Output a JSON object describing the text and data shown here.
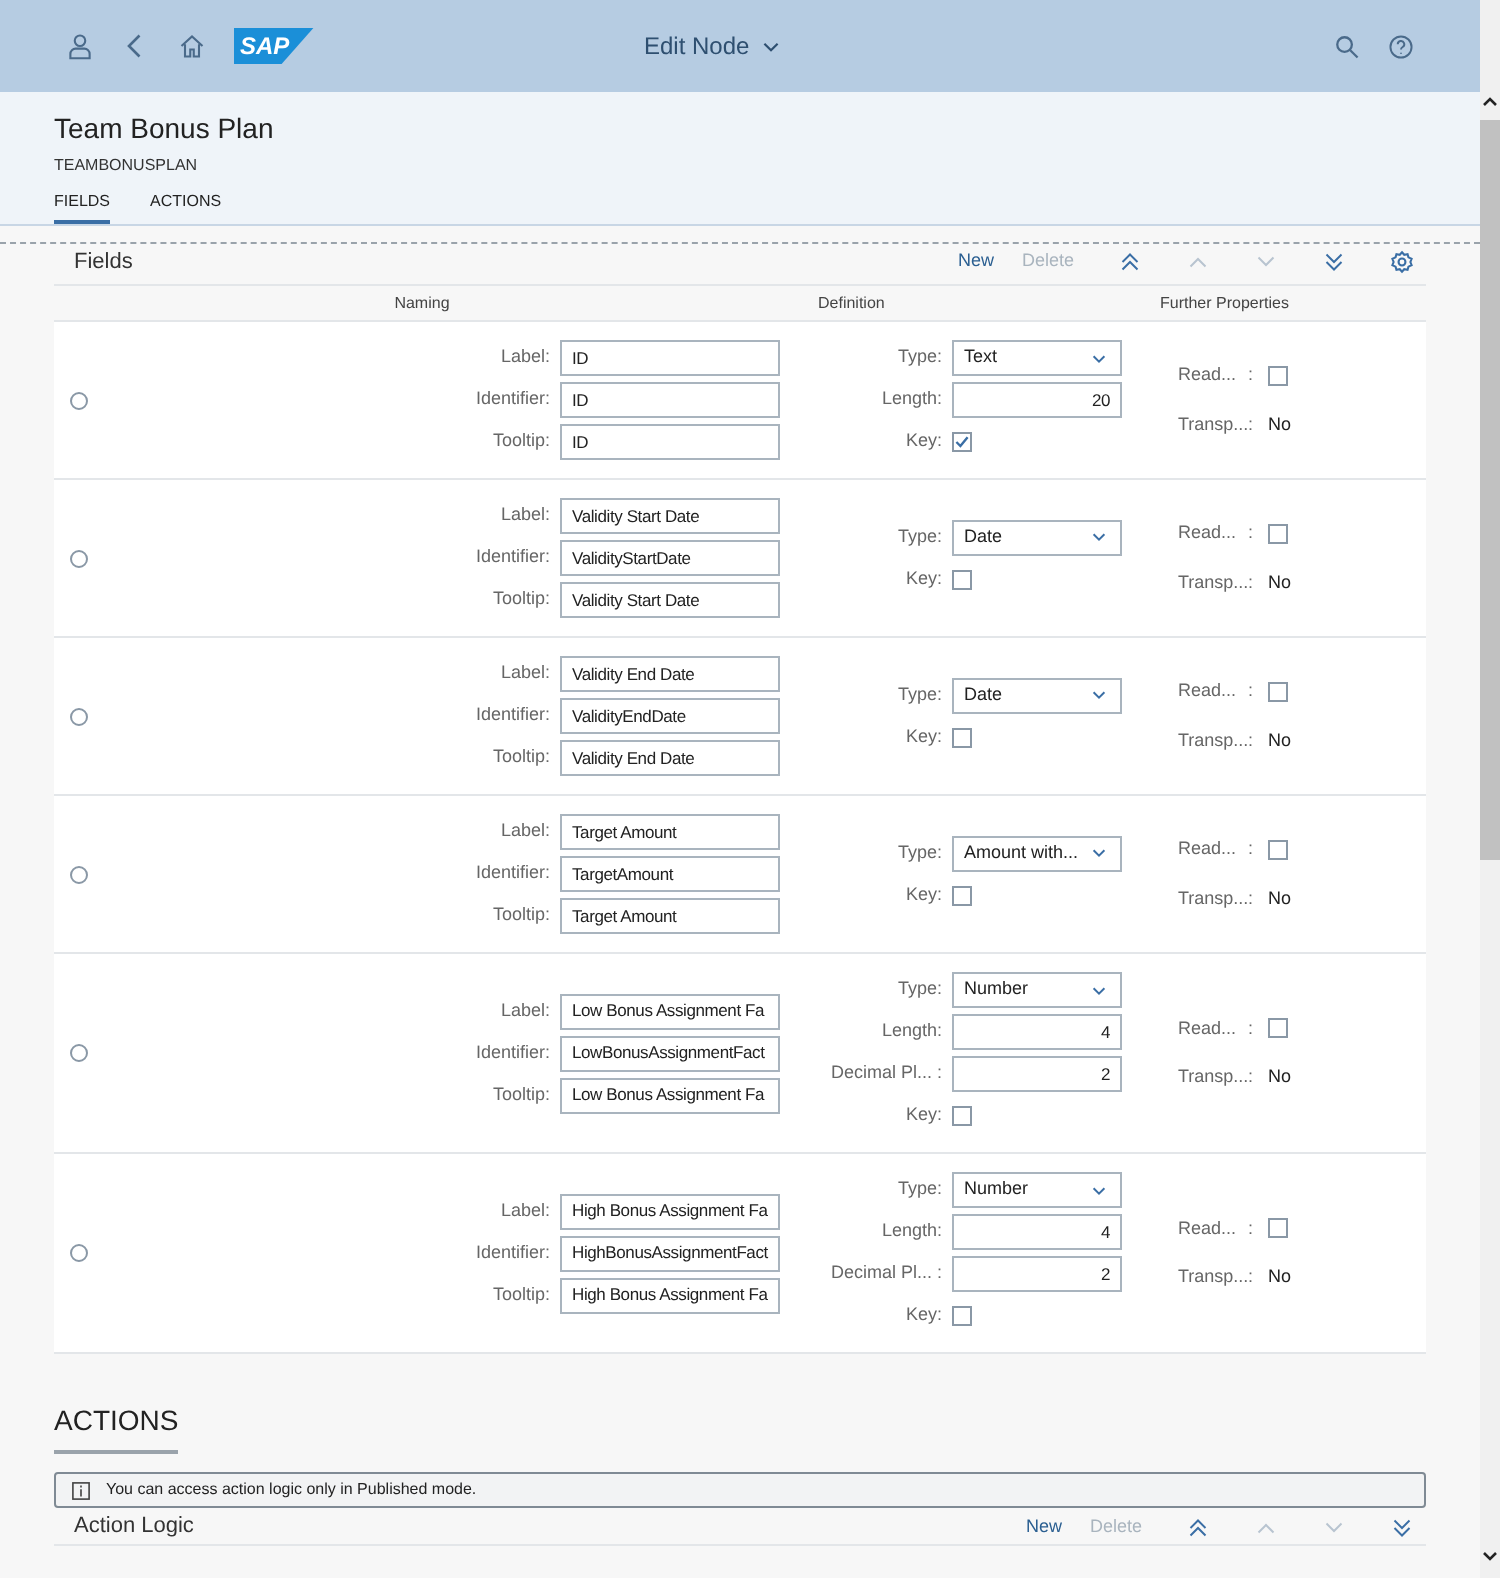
{
  "shell": {
    "title": "Edit Node",
    "logo": "SAP"
  },
  "header": {
    "title": "Team Bonus Plan",
    "subtitle": "TEAMBONUSPLAN"
  },
  "tabs": [
    {
      "label": "FIELDS",
      "selected": true
    },
    {
      "label": "ACTIONS",
      "selected": false
    }
  ],
  "fields": {
    "title": "Fields",
    "toolbar": {
      "new": {
        "label": "New",
        "disabled": false
      },
      "delete": {
        "label": "Delete",
        "disabled": true
      },
      "moves": [
        {
          "disabled": false
        },
        {
          "disabled": true
        },
        {
          "disabled": true
        },
        {
          "disabled": false
        }
      ]
    },
    "columns": [
      "Naming",
      "Definition",
      "Further Properties"
    ],
    "rows": [
      {
        "selected": false,
        "naming": [
          {
            "label": "Label:",
            "value": "ID"
          },
          {
            "label": "Identifier:",
            "value": "ID"
          },
          {
            "label": "Tooltip:",
            "value": "ID"
          }
        ],
        "definition": [
          {
            "kind": "select",
            "label": "Type:",
            "value": "Text"
          },
          {
            "kind": "number",
            "label": "Length:",
            "value": "20"
          },
          {
            "kind": "checkbox",
            "label": "Key:",
            "checked": true
          }
        ],
        "further": [
          {
            "kind": "checkbox",
            "label": "Read...",
            "colon": ":",
            "checked": false
          },
          {
            "kind": "text",
            "label": "Transp...",
            "colon": ":",
            "value": "No"
          }
        ]
      },
      {
        "selected": false,
        "naming": [
          {
            "label": "Label:",
            "value": "Validity Start Date"
          },
          {
            "label": "Identifier:",
            "value": "ValidityStartDate"
          },
          {
            "label": "Tooltip:",
            "value": "Validity Start Date"
          }
        ],
        "definition": [
          {
            "kind": "select",
            "label": "Type:",
            "value": "Date"
          },
          {
            "kind": "checkbox",
            "label": "Key:",
            "checked": false
          }
        ],
        "further": [
          {
            "kind": "checkbox",
            "label": "Read...",
            "colon": ":",
            "checked": false
          },
          {
            "kind": "text",
            "label": "Transp...",
            "colon": ":",
            "value": "No"
          }
        ]
      },
      {
        "selected": false,
        "naming": [
          {
            "label": "Label:",
            "value": "Validity End Date"
          },
          {
            "label": "Identifier:",
            "value": "ValidityEndDate"
          },
          {
            "label": "Tooltip:",
            "value": "Validity End Date"
          }
        ],
        "definition": [
          {
            "kind": "select",
            "label": "Type:",
            "value": "Date"
          },
          {
            "kind": "checkbox",
            "label": "Key:",
            "checked": false
          }
        ],
        "further": [
          {
            "kind": "checkbox",
            "label": "Read...",
            "colon": ":",
            "checked": false
          },
          {
            "kind": "text",
            "label": "Transp...",
            "colon": ":",
            "value": "No"
          }
        ]
      },
      {
        "selected": false,
        "naming": [
          {
            "label": "Label:",
            "value": "Target Amount"
          },
          {
            "label": "Identifier:",
            "value": "TargetAmount"
          },
          {
            "label": "Tooltip:",
            "value": "Target Amount"
          }
        ],
        "definition": [
          {
            "kind": "select",
            "label": "Type:",
            "value": "Amount with..."
          },
          {
            "kind": "checkbox",
            "label": "Key:",
            "checked": false
          }
        ],
        "further": [
          {
            "kind": "checkbox",
            "label": "Read...",
            "colon": ":",
            "checked": false
          },
          {
            "kind": "text",
            "label": "Transp...",
            "colon": ":",
            "value": "No"
          }
        ]
      },
      {
        "selected": false,
        "naming": [
          {
            "label": "Label:",
            "value": "Low Bonus Assignment Fa"
          },
          {
            "label": "Identifier:",
            "value": "LowBonusAssignmentFact"
          },
          {
            "label": "Tooltip:",
            "value": "Low Bonus Assignment Fa"
          }
        ],
        "definition": [
          {
            "kind": "select",
            "label": "Type:",
            "value": "Number"
          },
          {
            "kind": "number",
            "label": "Length:",
            "value": "4"
          },
          {
            "kind": "number",
            "label": "Decimal Pl... :",
            "value": "2"
          },
          {
            "kind": "checkbox",
            "label": "Key:",
            "checked": false
          }
        ],
        "further": [
          {
            "kind": "checkbox",
            "label": "Read...",
            "colon": ":",
            "checked": false
          },
          {
            "kind": "text",
            "label": "Transp...",
            "colon": ":",
            "value": "No"
          }
        ]
      },
      {
        "selected": false,
        "naming": [
          {
            "label": "Label:",
            "value": "High Bonus Assignment Fa"
          },
          {
            "label": "Identifier:",
            "value": "HighBonusAssignmentFact"
          },
          {
            "label": "Tooltip:",
            "value": "High Bonus Assignment Fa"
          }
        ],
        "definition": [
          {
            "kind": "select",
            "label": "Type:",
            "value": "Number"
          },
          {
            "kind": "number",
            "label": "Length:",
            "value": "4"
          },
          {
            "kind": "number",
            "label": "Decimal Pl... :",
            "value": "2"
          },
          {
            "kind": "checkbox",
            "label": "Key:",
            "checked": false
          }
        ],
        "further": [
          {
            "kind": "checkbox",
            "label": "Read...",
            "colon": ":",
            "checked": false
          },
          {
            "kind": "text",
            "label": "Transp...",
            "colon": ":",
            "value": "No"
          }
        ]
      }
    ]
  },
  "actions": {
    "heading": "ACTIONS",
    "info": "You can access action logic only in Published mode.",
    "title": "Action Logic",
    "toolbar": {
      "new": {
        "label": "New",
        "disabled": false
      },
      "delete": {
        "label": "Delete",
        "disabled": true
      },
      "moves": [
        {
          "disabled": false
        },
        {
          "disabled": true
        },
        {
          "disabled": true
        },
        {
          "disabled": false
        }
      ]
    }
  }
}
